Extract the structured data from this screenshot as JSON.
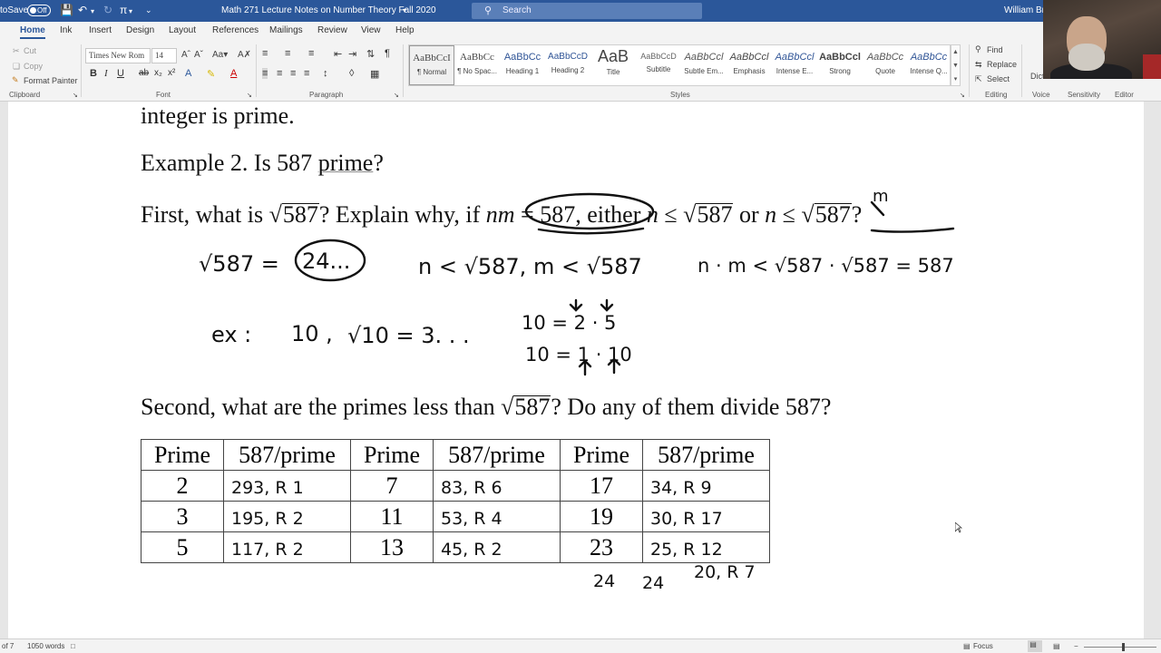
{
  "titlebar": {
    "autosave_label": "toSave",
    "autosave_state": "Off",
    "doc_title": "Math 271 Lecture Notes on Number Theory Fall 2020",
    "search_placeholder": "Search",
    "user_name": "William Bra"
  },
  "tabs": [
    "Home",
    "Ink",
    "Insert",
    "Design",
    "Layout",
    "References",
    "Mailings",
    "Review",
    "View",
    "Help"
  ],
  "active_tab": "Home",
  "ribbon": {
    "clipboard": {
      "cut": "Cut",
      "copy": "Copy",
      "format_painter": "Format Painter",
      "label": "Clipboard"
    },
    "font": {
      "name": "Times New Rom",
      "size": "14",
      "label": "Font"
    },
    "paragraph": {
      "label": "Paragraph"
    },
    "styles": {
      "label": "Styles",
      "items": [
        {
          "sample": "AaBbCcI",
          "name": "¶ Normal"
        },
        {
          "sample": "AaBbCc",
          "name": "¶ No Spac..."
        },
        {
          "sample": "AaBbCc",
          "name": "Heading 1"
        },
        {
          "sample": "AaBbCcD",
          "name": "Heading 2"
        },
        {
          "sample": "AaB",
          "name": "Title"
        },
        {
          "sample": "AaBbCcD",
          "name": "Subtitle"
        },
        {
          "sample": "AaBbCcl",
          "name": "Subtle Em..."
        },
        {
          "sample": "AaBbCcl",
          "name": "Emphasis"
        },
        {
          "sample": "AaBbCcl",
          "name": "Intense E..."
        },
        {
          "sample": "AaBbCcl",
          "name": "Strong"
        },
        {
          "sample": "AaBbCc",
          "name": "Quote"
        },
        {
          "sample": "AaBbCc",
          "name": "Intense Q..."
        }
      ]
    },
    "editing": {
      "find": "Find",
      "replace": "Replace",
      "select": "Select",
      "label": "Editing"
    },
    "voice": {
      "dictate": "Dict",
      "label": "Voice"
    },
    "sensitivity": {
      "label": "Sensitivity"
    },
    "editor": {
      "label": "Editor"
    }
  },
  "document": {
    "line1": "integer is prime.",
    "example2_prefix": "Example 2.  Is 587 ",
    "example2_word": "prime",
    "example2_suffix": "?",
    "first_a": "First, what is ",
    "first_sqrt": "587",
    "first_b": "?  Explain why, if ",
    "first_nm": "nm",
    "first_eq": " = 587, either ",
    "first_n": "n",
    "first_le": " ≤ ",
    "first_sqrt2": "587",
    "first_or": " or ",
    "first_m": "n",
    "first_le2": " ≤ ",
    "first_sqrt3": "587",
    "first_end": "?",
    "second_a": "Second, what are the primes less than ",
    "second_sqrt": "587",
    "second_b": "?  Do any of them divide 587?"
  },
  "handwriting": {
    "sqrt_eq": "√587 = ",
    "sqrt_val": "24...",
    "ineq1": "n < √587,  m < √587",
    "ineq2": "n · m < √587 · √587 = 587",
    "ex_label": "ex :",
    "ex_10": "10 ,",
    "ex_sqrt10": "√10 = 3. . .",
    "fact1": "10 = 2 · 5",
    "fact2": "10 = 1 · 10",
    "m_mark": "m",
    "below_23": "24",
    "below_q1": "24",
    "below_q2": "20, R 7"
  },
  "table": {
    "headers": [
      "Prime",
      "587/prime",
      "Prime",
      "587/prime",
      "Prime",
      "587/prime"
    ],
    "rows": [
      [
        "2",
        "293, R 1",
        "7",
        "83, R 6",
        "17",
        "34, R 9"
      ],
      [
        "3",
        "195, R 2",
        "11",
        "53, R 4",
        "19",
        "30, R 17"
      ],
      [
        "5",
        "117, R 2",
        "13",
        "45, R 2",
        "23",
        "25, R 12"
      ]
    ]
  },
  "statusbar": {
    "page": "of 7",
    "words": "1050 words",
    "focus": "Focus"
  }
}
